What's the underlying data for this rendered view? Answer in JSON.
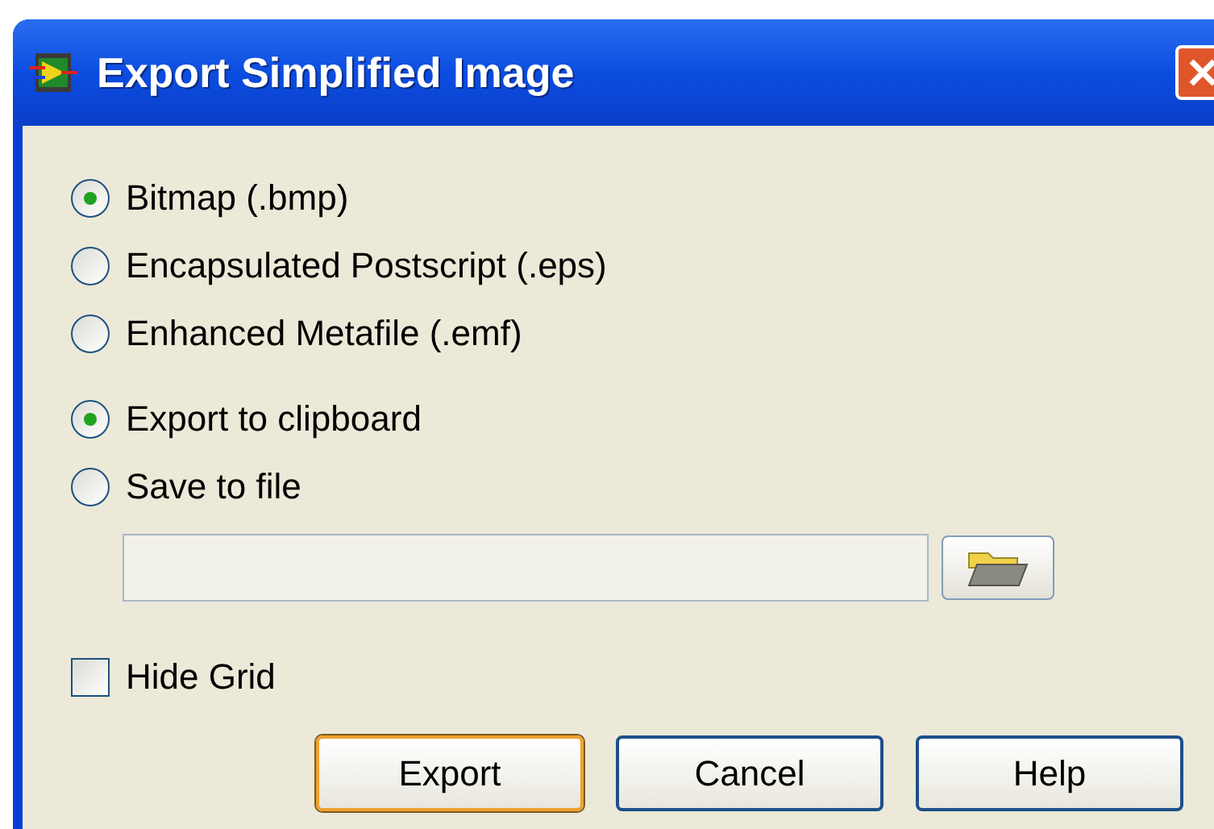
{
  "window": {
    "title": "Export Simplified Image"
  },
  "format_options": [
    {
      "label": "Bitmap (.bmp)",
      "selected": true
    },
    {
      "label": "Encapsulated Postscript (.eps)",
      "selected": false
    },
    {
      "label": "Enhanced Metafile (.emf)",
      "selected": false
    }
  ],
  "destination_options": [
    {
      "label": "Export to clipboard",
      "selected": true
    },
    {
      "label": "Save to file",
      "selected": false
    }
  ],
  "hide_grid": {
    "label": "Hide Grid",
    "checked": false
  },
  "buttons": [
    {
      "label": "Export",
      "default": true
    },
    {
      "label": "Cancel",
      "default": false
    },
    {
      "label": "Help",
      "default": false
    }
  ]
}
